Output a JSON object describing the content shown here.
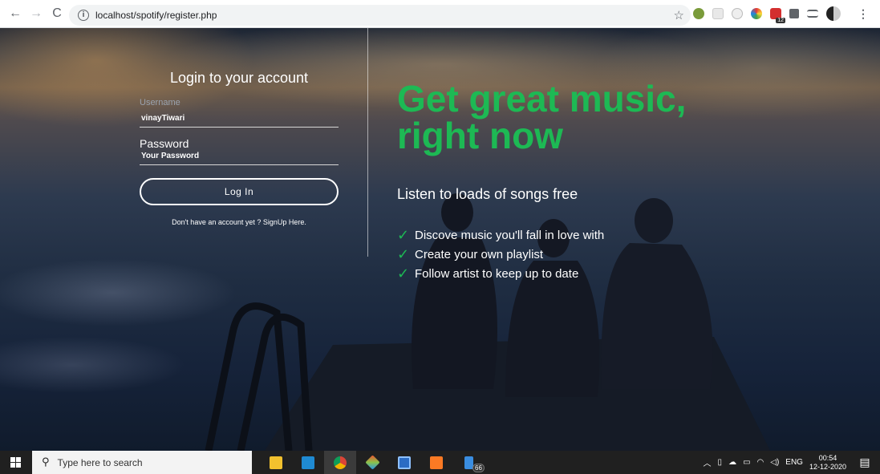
{
  "browser": {
    "url": "localhost/spotify/register.php",
    "extension_badge": "12"
  },
  "login": {
    "title": "Login to your account",
    "username_label": "Username",
    "username_value": "vinayTiwari",
    "password_label": "Password",
    "password_placeholder": "Your Password",
    "button_label": "Log In",
    "signup_text": "Don't have an account yet ? SignUp Here."
  },
  "promo": {
    "headline_line1": "Get great music,",
    "headline_line2": "right now",
    "subheading": "Listen to loads of songs free",
    "features": [
      "Discove music you'll fall in love with",
      "Create your own playlist",
      "Follow artist to keep up to date"
    ],
    "accent_color": "#1db954"
  },
  "taskbar": {
    "search_placeholder": "Type here to search",
    "explorer_badge": "66",
    "language": "ENG",
    "time": "00:54",
    "date": "12-12-2020"
  }
}
